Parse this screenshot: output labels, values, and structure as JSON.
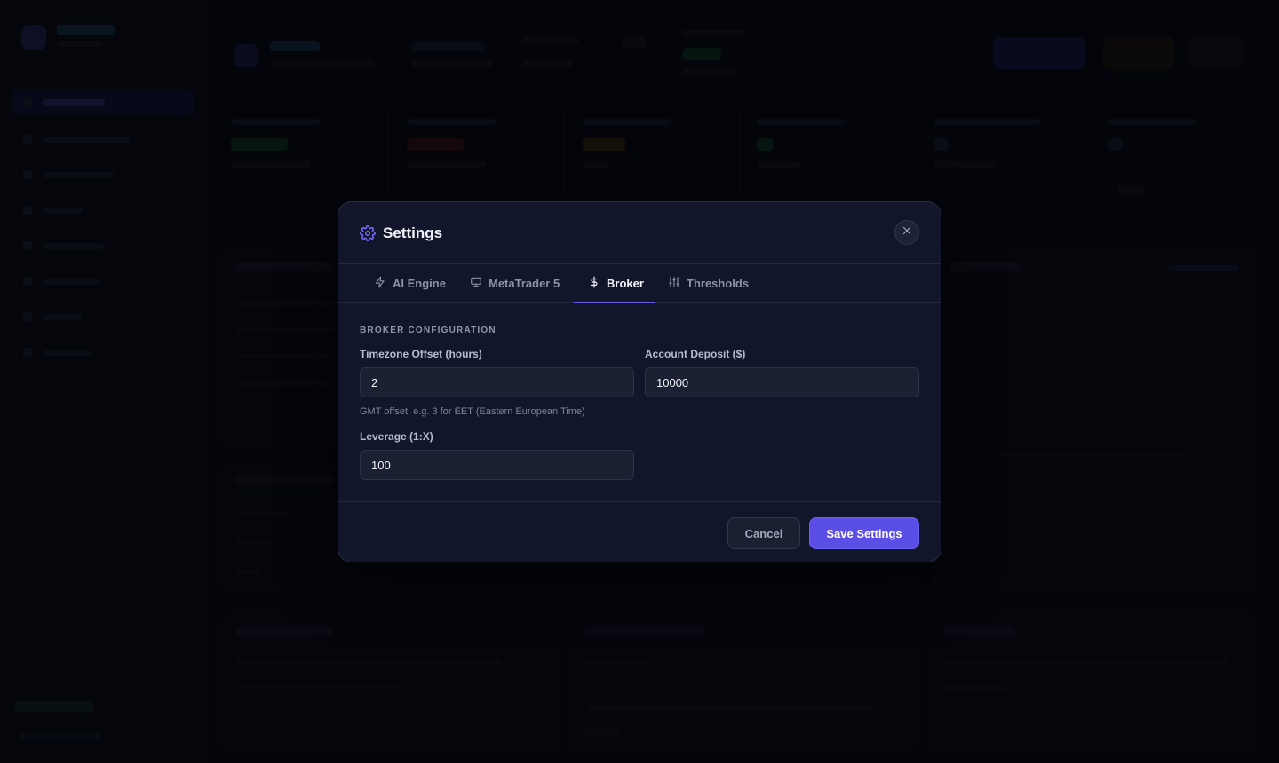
{
  "colors": {
    "accent": "#5b4ee6",
    "tab_indicator": "#6c5ce7",
    "modal_bg": "#11162a",
    "page_bg": "#07080f"
  },
  "modal": {
    "title": "Settings",
    "title_icon": "gear-icon",
    "close_icon": "close-icon"
  },
  "tabs": [
    {
      "label": "AI Engine",
      "icon": "lightning-icon",
      "active": false
    },
    {
      "label": "MetaTrader 5",
      "icon": "monitor-icon",
      "active": false
    },
    {
      "label": "Broker",
      "icon": "dollar-icon",
      "active": true
    },
    {
      "label": "Thresholds",
      "icon": "sliders-icon",
      "active": false
    }
  ],
  "broker": {
    "section_title": "BROKER CONFIGURATION",
    "timezone": {
      "label": "Timezone Offset (hours)",
      "value": "2",
      "help": "GMT offset, e.g. 3 for EET (Eastern European Time)"
    },
    "deposit": {
      "label": "Account Deposit ($)",
      "value": "10000"
    },
    "leverage": {
      "label": "Leverage (1:X)",
      "value": "100"
    }
  },
  "footer": {
    "cancel_label": "Cancel",
    "save_label": "Save Settings"
  }
}
